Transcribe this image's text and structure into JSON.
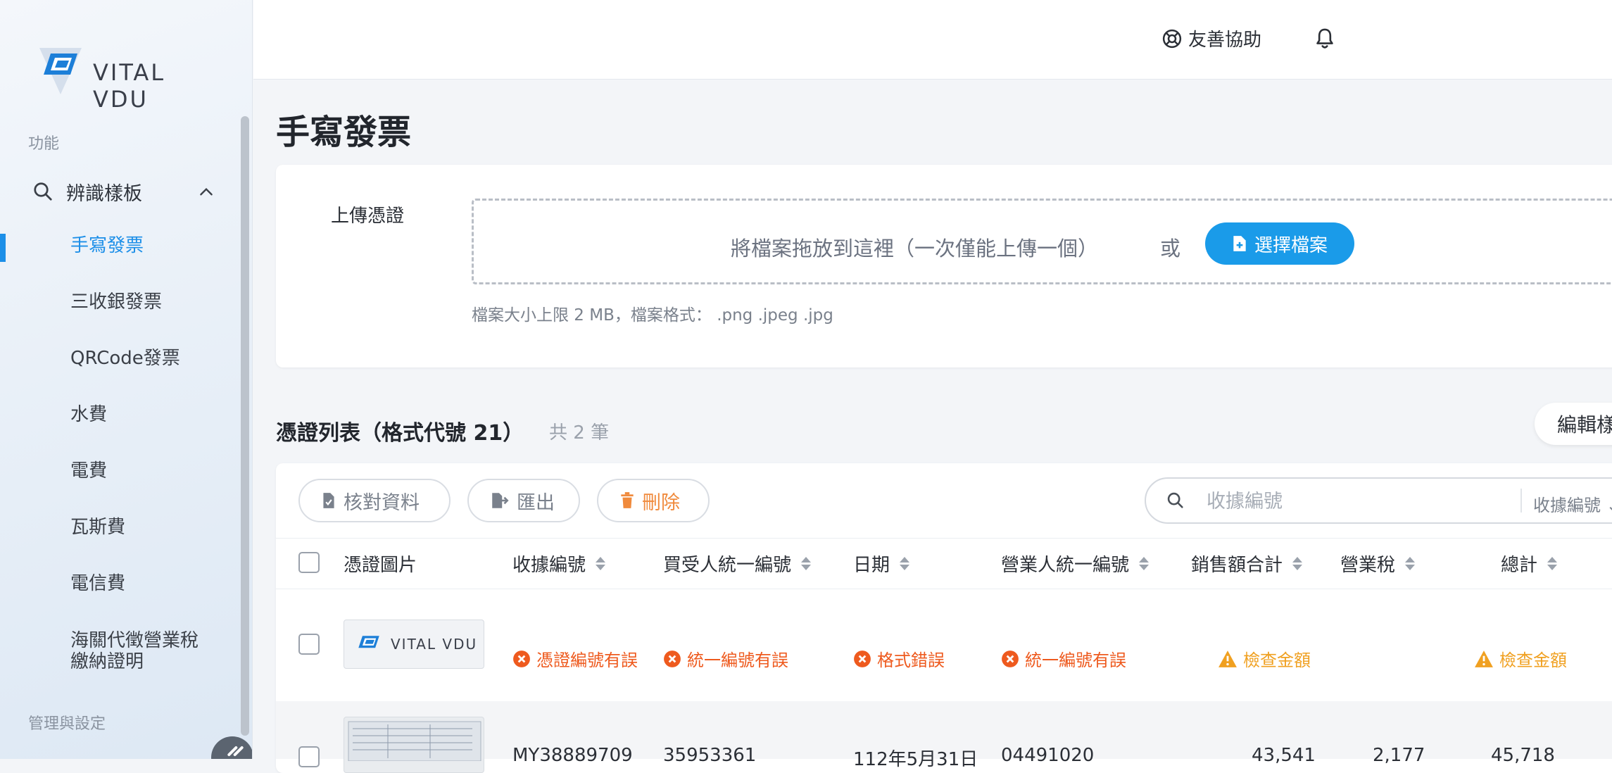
{
  "brand": {
    "logo_text": "VITAL VDU"
  },
  "sidebar": {
    "section_features": "功能",
    "group": {
      "label": "辨識樣板",
      "icon": "search-icon",
      "expanded": true
    },
    "items": [
      {
        "label": "手寫發票",
        "active": true
      },
      {
        "label": "三收銀發票"
      },
      {
        "label": "QRCode發票"
      },
      {
        "label": "水費"
      },
      {
        "label": "電費"
      },
      {
        "label": "瓦斯費"
      },
      {
        "label": "電信費"
      },
      {
        "label": "海關代徵營業稅\n繳納證明"
      }
    ],
    "section_admin": "管理與設定"
  },
  "topbar": {
    "help_label": "友善協助",
    "help_icon": "lifebuoy-icon",
    "bell_icon": "bell-icon"
  },
  "page": {
    "title": "手寫發票"
  },
  "upload": {
    "label": "上傳憑證",
    "drop_text": "將檔案拖放到這裡（一次僅能上傳一個）",
    "or_text": "或",
    "choose_button": "選擇檔案",
    "hint": "檔案大小上限 2 MB，檔案格式： .png .jpeg .jpg"
  },
  "list": {
    "title": "憑證列表（格式代號 21）",
    "count": "共 2 筆",
    "edit_button": "編輯樣",
    "toolbar": {
      "verify": "核對資料",
      "export": "匯出",
      "delete": "刪除"
    },
    "search": {
      "placeholder": "收據編號",
      "field": "收據編號"
    },
    "columns": [
      "憑證圖片",
      "收據編號",
      "買受人統一編號",
      "日期",
      "營業人統一編號",
      "銷售額合計",
      "營業稅",
      "總計"
    ],
    "rows": [
      {
        "thumb_text": "VITAL VDU",
        "receipt_no": "憑證編號有誤",
        "buyer_id": "統一編號有誤",
        "date": "格式錯誤",
        "seller_id": "統一編號有誤",
        "sales_total": "檢查金額",
        "total": "檢查金額"
      },
      {
        "receipt_no": "MY38889709",
        "buyer_id": "35953361",
        "date": "112年5月31日",
        "seller_id": "04491020",
        "sales_total": "43,541",
        "tax": "2,177",
        "total": "45,718"
      }
    ]
  },
  "colors": {
    "accent": "#1c8fe8",
    "error": "#ee5a1e",
    "warning": "#f0a020",
    "delete": "#f08a3c"
  }
}
